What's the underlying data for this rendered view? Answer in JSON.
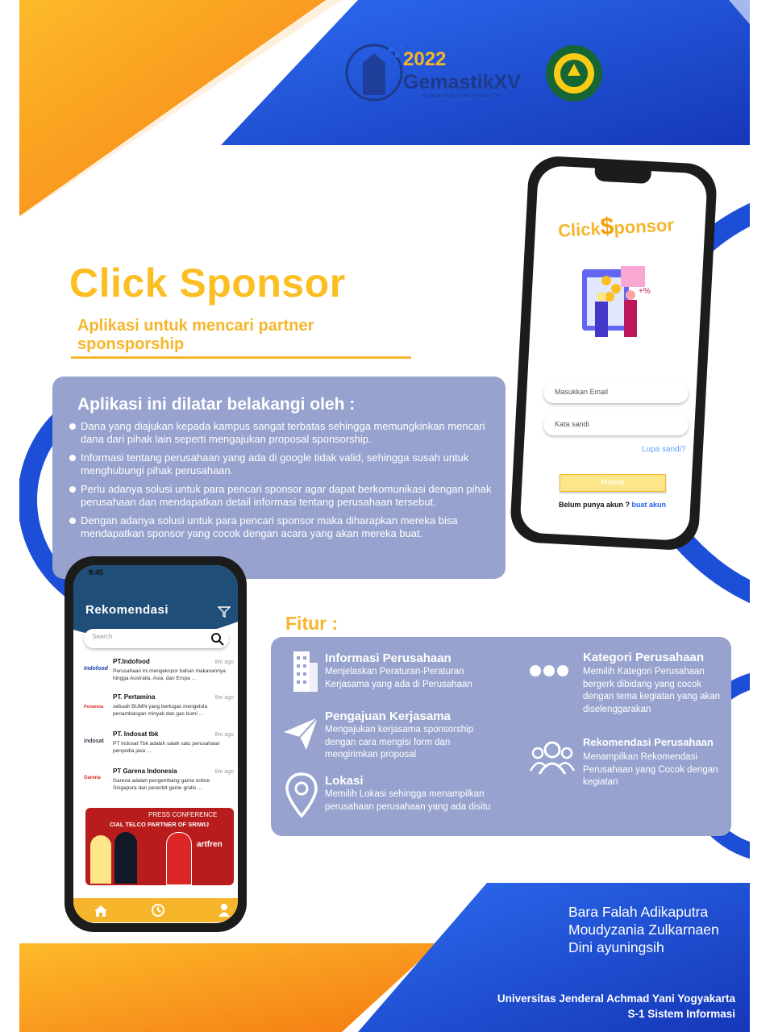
{
  "header": {
    "year": "2022",
    "event_name": "GemastikXV",
    "event_tagline": "Pagelaran Mahasiswa Nasional Bidang TIK"
  },
  "poster": {
    "title": "Click Sponsor",
    "subtitle": "Aplikasi untuk mencari partner sponsporship"
  },
  "background": {
    "heading": "Aplikasi ini dilatar belakangi oleh :",
    "points": [
      "Dana yang diajukan kepada kampus sangat terbatas sehingga memungkinkan mencari dana dari pihak lain seperti mengajukan proposal sponsorship.",
      "Informasi tentang perusahaan yang ada di google tidak valid, sehingga susah untuk menghubungi pihak perusahaan.",
      "Perlu adanya solusi untuk para pencari sponsor agar dapat berkomunikasi dengan pihak perusahaan dan mendapatkan detail informasi tentang perusahaan tersebut.",
      "Dengan adanya solusi untuk para pencari sponsor maka diharapkan mereka bisa mendapatkan sponsor yang cocok dengan acara yang akan mereka buat."
    ]
  },
  "login_phone": {
    "logo_part1": "Click",
    "logo_dollar": "$",
    "logo_part2": "ponsor",
    "email_placeholder": "Masukkan Email",
    "password_placeholder": "Kata sandi",
    "forgot": "Lupa sandi?",
    "login_button": "Masuk",
    "no_account": "Belum punya akun ?",
    "create_account": "buat akun"
  },
  "reco_phone": {
    "time": "9:45",
    "title": "Rekomendasi",
    "search_placeholder": "Search",
    "items": [
      {
        "name": "PT.Indofood",
        "logo": "Indofood",
        "time": "8m ago",
        "desc": "Perusahaan ini mengekspor bahan makanannya hingga Australia, Asia, dan Eropa ..."
      },
      {
        "name": "PT. Pertamina",
        "logo": "Pertamina",
        "time": "8m ago",
        "desc": "sebuah BUMN yang bertugas mengelola penambangan minyak dan gas bumi ..."
      },
      {
        "name": "PT. Indosat tbk",
        "logo": "indosat",
        "time": "8m ago",
        "desc": "PT Indosat Tbk adalah salah satu perusahaan penyedia jasa ..."
      },
      {
        "name": "PT Garena Indonesia",
        "logo": "Garena",
        "time": "8m ago",
        "desc": "Garena adalah pengembang game online Singapura dan penerbit game gratis ..."
      }
    ],
    "banner_line1": "PRESS CONFERENCE",
    "banner_line2": "CIAL TELCO PARTNER OF SRIWIJ",
    "banner_brand": "artfren"
  },
  "features": {
    "heading": "Fitur :",
    "items": [
      {
        "title": "Informasi Perusahaan",
        "desc": "Menjelaskan Peraturan-Peraturan Kerjasama yang ada di Perusahaan"
      },
      {
        "title": "Pengajuan Kerjasama",
        "desc": "Mengajukan kerjasama sponsorship dengan cara mengisi form dan mengirimkan proposal"
      },
      {
        "title": "Lokasi",
        "desc": "Memilih Lokasi sehingga menampilkan perusahaan perusahaan yang ada disitu"
      },
      {
        "title": "Kategori Perusahaan",
        "desc": "Memilih Kategori Perusahaan bergerk dibidang yang cocok dengan tema kegiatan yang akan diselenggarakan"
      },
      {
        "title": "Rekomendasi Perusahaan",
        "desc": "Menampilkan Rekomendasi Perusahaan yang Cocok dengan kegiatan"
      }
    ]
  },
  "authors": [
    "Bara Falah Adikaputra",
    "Moudyzania Zulkarnaen",
    "Dini ayuningsih"
  ],
  "university": {
    "name": "Universitas Jenderal Achmad Yani Yogyakarta",
    "program": "S-1 Sistem Informasi"
  },
  "colors": {
    "orange": "#F7941D",
    "yellow": "#F6B52B",
    "blue": "#1D4ED8",
    "lavender": "#97A3CE"
  }
}
